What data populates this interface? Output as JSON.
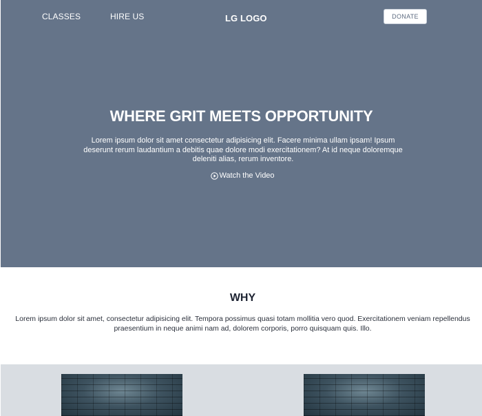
{
  "nav": {
    "classes": "CLASSES",
    "hire_us": "HIRE US",
    "logo": "LG LOGO",
    "donate": "DONATE"
  },
  "hero": {
    "title": "WHERE GRIT MEETS OPPORTUNITY",
    "text": "Lorem ipsum dolor sit amet consectetur adipisicing elit. Facere minima ullam ipsam! Ipsum deserunt rerum laudantium a debitis quae dolore modi exercitationem? At id neque doloremque deleniti alias, rerum inventore.",
    "watch_label": "Watch the Video",
    "watch_icon": "play-circle-icon"
  },
  "why": {
    "title": "WHY",
    "text": "Lorem ipsum dolor sit amet, consectetur adipisicing elit. Tempora possimus quasi totam mollitia vero quod. Exercitationem veniam repellendus praesentium in neque animi nam ad, dolorem corporis, porro quisquam quis. Illo."
  },
  "colors": {
    "hero_bg": "#657489",
    "gallery_bg": "#d9dde2",
    "heading": "#1e2433"
  }
}
